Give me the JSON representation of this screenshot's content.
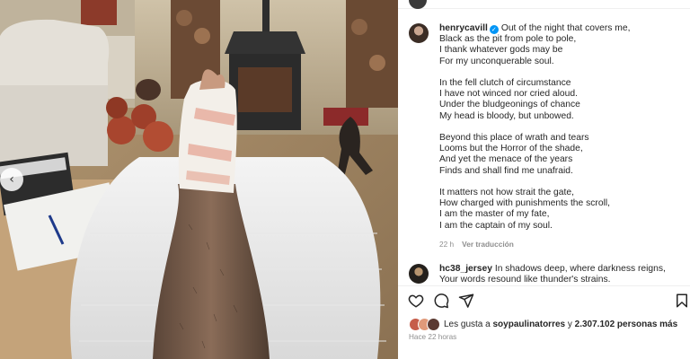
{
  "post": {
    "username": "henrycavill",
    "verified": true,
    "caption": [
      [
        "Out of the night that covers me,",
        "Black as the pit from pole to pole,",
        "I thank whatever gods may be",
        "For my unconquerable soul."
      ],
      [
        "In the fell clutch of circumstance",
        "I have not winced nor cried aloud.",
        "Under the bludgeonings of chance",
        "My head is bloody, but unbowed."
      ],
      [
        "Beyond this place of wrath and tears",
        "Looms but the Horror of the shade,",
        "And yet the menace of the years",
        "Finds and shall find me unafraid."
      ],
      [
        "It matters not how strait the gate,",
        "How charged with punishments the scroll,",
        "I am the master of my fate,",
        "I am the captain of my soul."
      ]
    ],
    "age": "22 h",
    "translate_label": "Ver traducción"
  },
  "comments": [
    {
      "username": "hc38_jersey",
      "text": "In shadows deep, where darkness reigns,",
      "text2": "Your words resound like thunder's strains."
    }
  ],
  "likes": {
    "prefix": "Les gusta a",
    "user": "soypaulinatorres",
    "connector": "y",
    "count": "2.307.102 personas más"
  },
  "timestamp": "Hace 22 horas",
  "icons": [
    "heart-icon",
    "comment-icon",
    "share-icon",
    "bookmark-icon",
    "chevron-left-icon",
    "verified-icon"
  ],
  "colors": {
    "verified": "#0095f6",
    "secondary_text": "#8e8e8e"
  }
}
